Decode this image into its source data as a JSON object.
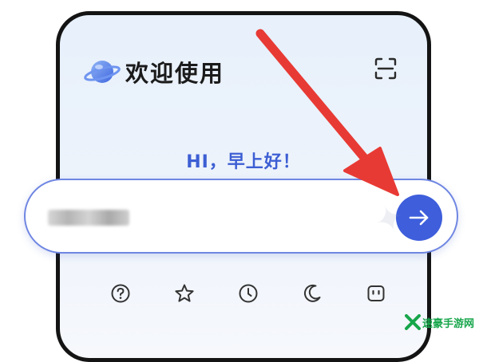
{
  "app": {
    "title": "欢迎使用",
    "subtitle": "",
    "greeting": "HI，早上好！"
  },
  "scan": {
    "icon": "scan-icon",
    "label": ""
  },
  "search": {
    "value": "",
    "placeholder": "",
    "submit_icon": "arrow-right-icon",
    "accent_color": "#3e5edb",
    "border_color": "#6f86e2"
  },
  "shortcuts": [
    {
      "icon": "help-icon",
      "label": ""
    },
    {
      "icon": "star-icon",
      "label": ""
    },
    {
      "icon": "clock-icon",
      "label": ""
    },
    {
      "icon": "moon-icon",
      "label": ""
    },
    {
      "icon": "robot-icon",
      "label": ""
    }
  ],
  "overlay": {
    "annotation": "red-pointer-arrow",
    "color": "#e83a34"
  },
  "watermark": {
    "site_name": "速豪手游网",
    "logo_color": "#17a64b"
  }
}
